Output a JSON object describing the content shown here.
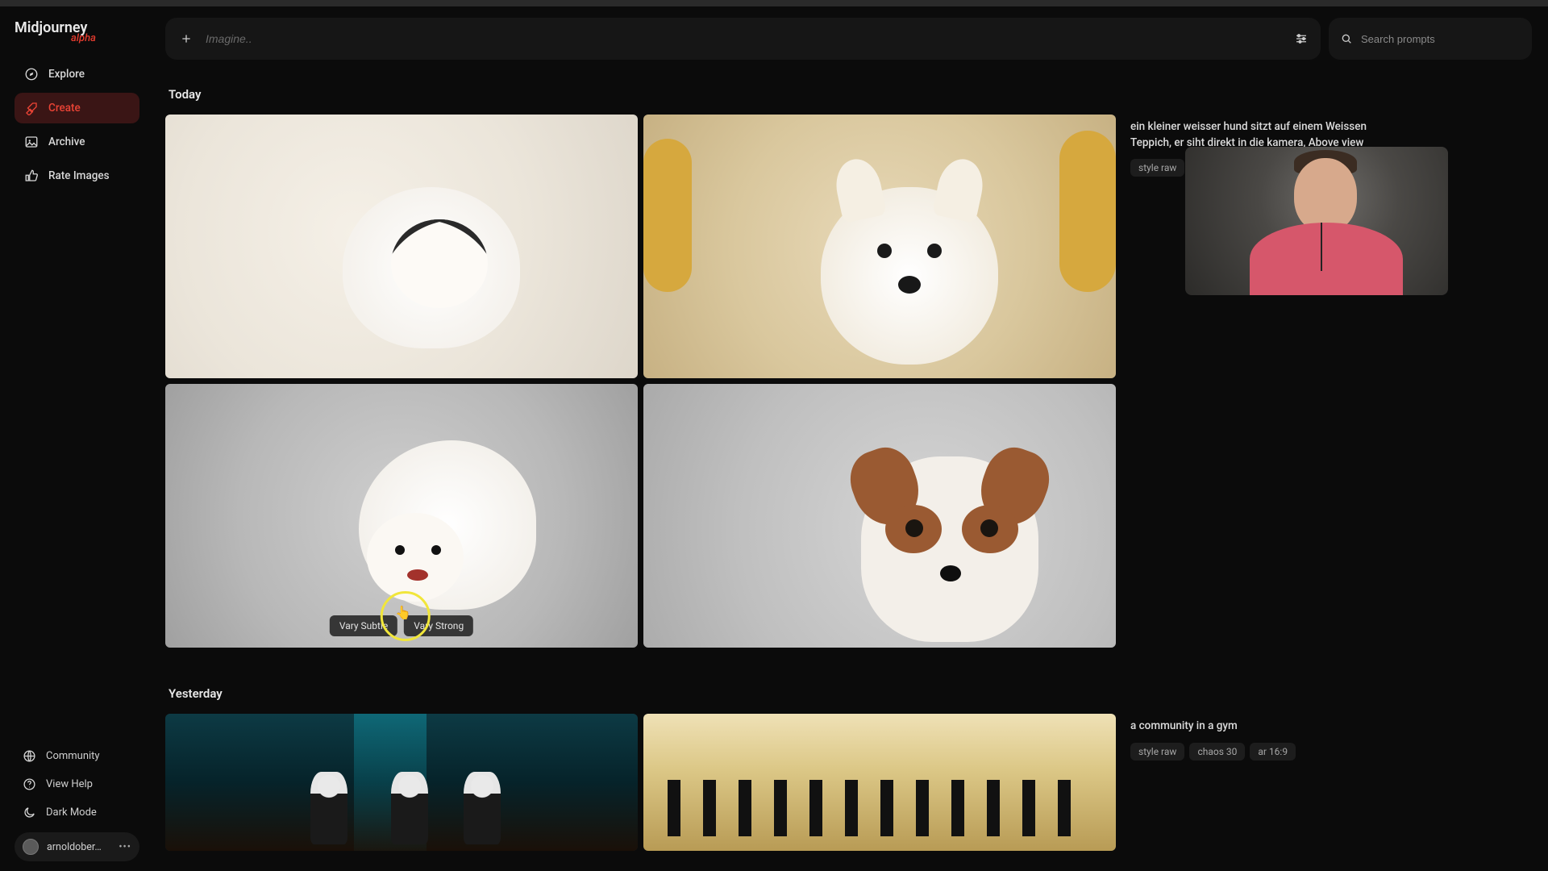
{
  "brand": {
    "name": "Midjourney",
    "badge": "alpha"
  },
  "sidebar": {
    "items": [
      {
        "label": "Explore"
      },
      {
        "label": "Create"
      },
      {
        "label": "Archive"
      },
      {
        "label": "Rate Images"
      }
    ],
    "bottom": [
      {
        "label": "Community"
      },
      {
        "label": "View Help"
      },
      {
        "label": "Dark Mode"
      }
    ],
    "user": "arnoldober…"
  },
  "imagine_placeholder": "Imagine..",
  "search_placeholder": "Search prompts",
  "sections": {
    "today": "Today",
    "yesterday": "Yesterday"
  },
  "prompts": {
    "today": "ein kleiner weisser hund sitzt auf einem Weissen Teppich, er siht direkt in die kamera, Above view",
    "today_tags": [
      "style raw"
    ],
    "yesterday": "a community in a gym",
    "yesterday_tags": [
      "style raw",
      "chaos 30",
      "ar 16:9"
    ]
  },
  "vary": {
    "subtle": "Vary Subtle",
    "strong": "Vary Strong"
  }
}
